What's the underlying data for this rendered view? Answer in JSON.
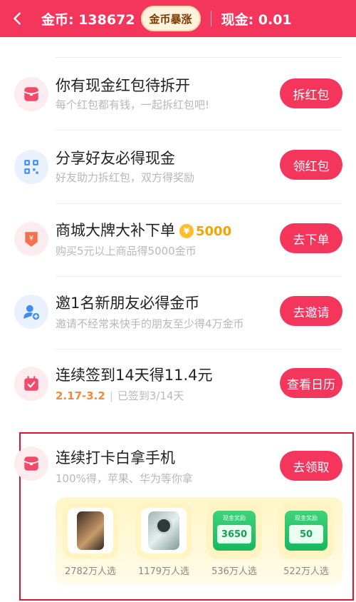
{
  "header": {
    "coins_text": "金币: 138672",
    "boost_label": "金币暴涨",
    "cash_text": "现金: 0.01"
  },
  "tasks": [
    {
      "title": "你有现金红包待拆开",
      "subtitle": "每个红包都有钱，一起拆红包吧!",
      "button": "拆红包",
      "icon": "red-envelope-icon"
    },
    {
      "title": "分享好友必得现金",
      "subtitle": "好友助力拆红包，双方得奖励",
      "button": "领红包",
      "icon": "qrcode-icon"
    },
    {
      "title": "商城大牌大补下单",
      "badge": "5000",
      "subtitle": "购买5元以上商品得5000金币",
      "button": "去下单",
      "icon": "yuan-tag-icon"
    },
    {
      "title": "邀1名新朋友必得金币",
      "subtitle": "邀请不经常来快手的朋友至少得4万金币",
      "button": "去邀请",
      "icon": "add-user-icon"
    },
    {
      "title": "连续签到14天得11.4元",
      "date_range": "2.17-3.2",
      "progress_text": "已签到3/14天",
      "button": "查看日历",
      "icon": "calendar-check-icon"
    },
    {
      "title": "连续打卡白拿手机",
      "subtitle": "100%得，苹果、华为等你拿",
      "button": "去领取",
      "icon": "red-envelope-icon"
    }
  ],
  "prizes": [
    {
      "label": "2782万人选",
      "kind": "iphone"
    },
    {
      "label": "1179万人选",
      "kind": "huawei-phone"
    },
    {
      "label": "536万人选",
      "kind": "cash",
      "caption": "现金奖励",
      "amount": "3650"
    },
    {
      "label": "522万人选",
      "kind": "cash",
      "caption": "现金奖励",
      "amount": "50"
    }
  ]
}
